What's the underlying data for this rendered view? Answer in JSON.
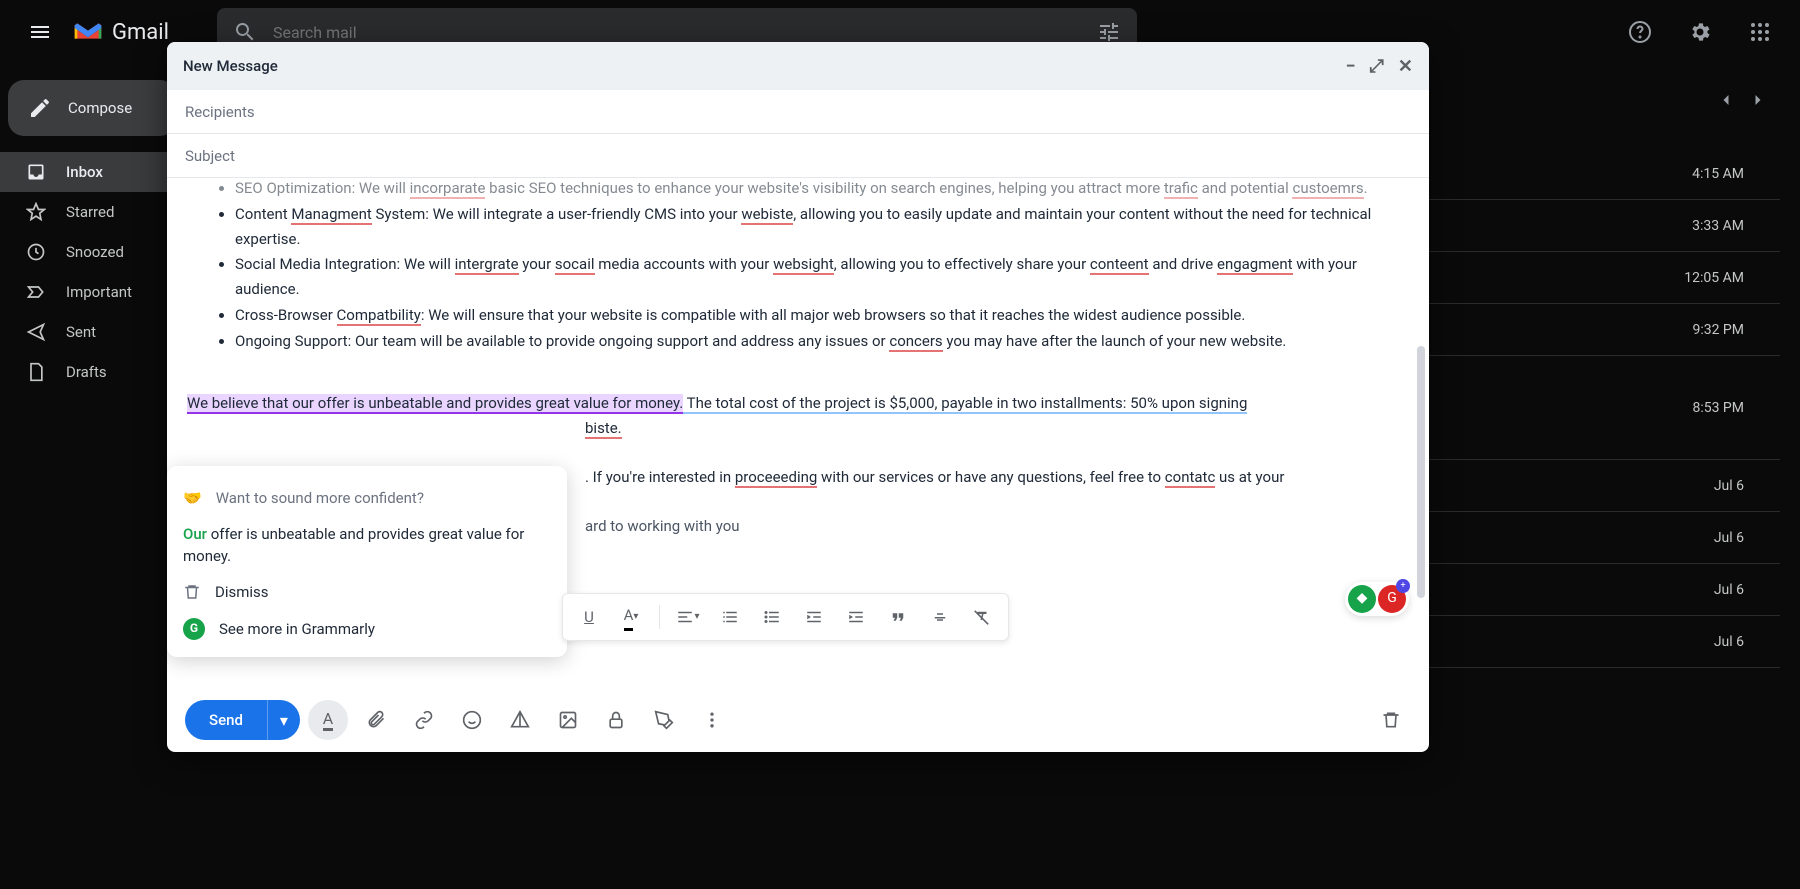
{
  "header": {
    "gmail_label": "Gmail",
    "search_placeholder": "Search mail"
  },
  "sidebar": {
    "compose": "Compose",
    "items": [
      {
        "label": "Inbox"
      },
      {
        "label": "Starred"
      },
      {
        "label": "Snoozed"
      },
      {
        "label": "Important"
      },
      {
        "label": "Sent"
      },
      {
        "label": "Drafts"
      }
    ]
  },
  "mail_times": [
    "4:15 AM",
    "3:33 AM",
    "12:05 AM",
    "9:32 PM",
    "8:53 PM",
    "Jul 6",
    "Jul 6",
    "Jul 6",
    "Jul 6"
  ],
  "compose": {
    "title": "New Message",
    "recipients_placeholder": "Recipients",
    "subject_placeholder": "Subject",
    "send": "Send",
    "body_cut": "SEO Optimization: We will incorparate basic SEO techniques to enhance your website's visibility on search engines, helping you attract more trafic and potential custoemrs.",
    "b1_a": "Content ",
    "b1_sp": "Managment",
    "b1_b": " System: We will integrate a user-friendly CMS into your ",
    "b1_sp2": "webiste",
    "b1_c": ", allowing you to easily update and maintain your content without the need for technical expertise.",
    "b2_a": "Social Media Integration: We will ",
    "b2_sp": "intergrate",
    "b2_b": " your ",
    "b2_sp2": "socail",
    "b2_c": " media accounts with your ",
    "b2_sp3": "websight",
    "b2_d": ", allowing you to effectively share your ",
    "b2_sp4": "conteent",
    "b2_e": " and drive ",
    "b2_sp5": "engagment",
    "b2_f": " with your audience.",
    "b3_a": "Cross-Browser ",
    "b3_sp": "Compatbility",
    "b3_b": ": We will ensure that your website is compatible with all major web browsers so that it reaches the widest audience possible.",
    "b4_a": "Ongoing Support: Our team will be available to provide ongoing support and address any issues or ",
    "b4_sp": "concers",
    "b4_b": " you may have after the launch of your new website.",
    "p1_a": "We believe that our offer is unbeatable and provides great value for money.",
    "p1_b": " The total cost of the project is $5,000, payable in two installments: 50% upon signing",
    "p1_c": "biste.",
    "p2_a": ". If you're interested in ",
    "p2_sp": "proceeeding",
    "p2_b": " with our services or have any questions, feel free to ",
    "p2_sp2": "contatc",
    "p2_c": " us at your",
    "p3": "ard to working with you"
  },
  "grammarly": {
    "prompt": "Want to sound more confident?",
    "emoji": "🤝",
    "suggest_strong": "Our",
    "suggest_rest": " offer is unbeatable and provides great value for money.",
    "dismiss": "Dismiss",
    "more": "See more in Grammarly"
  }
}
